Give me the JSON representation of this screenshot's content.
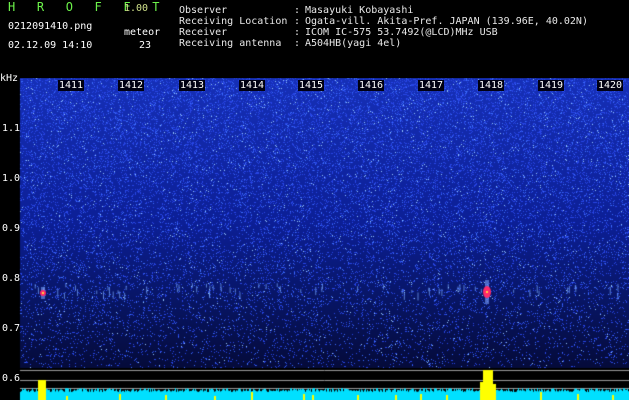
{
  "header": {
    "app_title": "H R O F F T",
    "app_version": "1.00",
    "file_name": "0212091410.png",
    "timestamp": "02.12.09 14:10",
    "meteor_label": "meteor",
    "meteor_count": "23",
    "info": [
      {
        "key": "Observer",
        "sep": ":",
        "value": "Masayuki Kobayashi"
      },
      {
        "key": "Receiving Location",
        "sep": ":",
        "value": "Ogata-vill. Akita-Pref. JAPAN (139.96E, 40.02N)"
      },
      {
        "key": "Receiver",
        "sep": ":",
        "value": "ICOM IC-575 53.7492(@LCD)MHz USB"
      },
      {
        "key": "Receiving antenna",
        "sep": ":",
        "value": "A504HB(yagi 4el)"
      }
    ]
  },
  "spectrogram": {
    "y_unit": "kHz",
    "y_ticks": [
      "1.1",
      "1.0",
      "0.9",
      "0.8",
      "0.7",
      "0.6"
    ],
    "x_ticks": [
      "1411",
      "1412",
      "1413",
      "1414",
      "1415",
      "1416",
      "1417",
      "1418",
      "1419",
      "1420"
    ],
    "colors": {
      "background": "#0a1a8c",
      "noise": "#3a5cff",
      "echo": "#ff2a6a",
      "level": "#ffff00",
      "baseline": "#00e0ff"
    }
  }
}
